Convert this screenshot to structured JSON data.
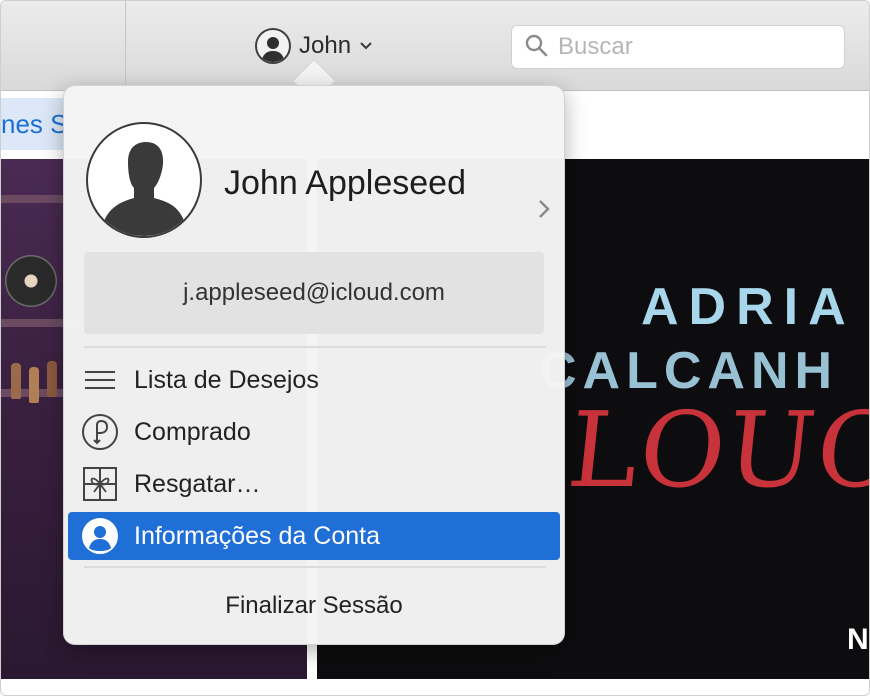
{
  "toolbar": {
    "account_name": "John",
    "search_placeholder": "Buscar"
  },
  "store_tab": {
    "label": "nes S"
  },
  "album": {
    "line1": "ADRIA",
    "line2": "CALCANH",
    "line3": "LOUCU",
    "badge": "N"
  },
  "popover": {
    "full_name": "John Appleseed",
    "email": "j.appleseed@icloud.com",
    "menu": [
      {
        "label": "Lista de Desejos",
        "icon": "list-icon"
      },
      {
        "label": "Comprado",
        "icon": "purchased-icon"
      },
      {
        "label": "Resgatar…",
        "icon": "gift-icon"
      },
      {
        "label": "Informações da Conta",
        "icon": "account-info-icon",
        "selected": true
      }
    ],
    "logout_label": "Finalizar Sessão"
  },
  "colors": {
    "accent": "#1f6fd6",
    "toolbar_bg": "#e3e3e3",
    "popover_bg": "#f4f4f4",
    "album_blue": "#a8d6ea",
    "album_red": "#c8323a"
  }
}
